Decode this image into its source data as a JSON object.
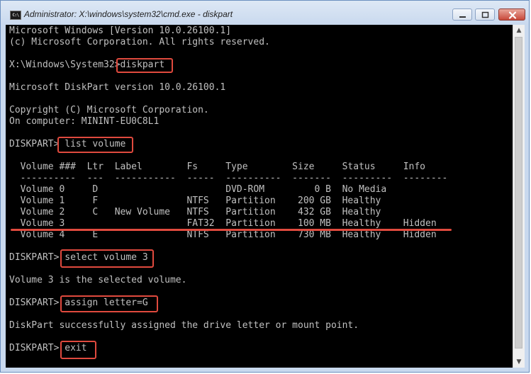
{
  "window": {
    "title": "Administrator: X:\\windows\\system32\\cmd.exe - diskpart",
    "icon_label": "C:\\",
    "icon_name": "cmd-icon"
  },
  "controls": {
    "minimize": "minimize-icon",
    "maximize": "maximize-icon",
    "close": "close-icon"
  },
  "console": {
    "lines": [
      "Microsoft Windows [Version 10.0.26100.1]",
      "(c) Microsoft Corporation. All rights reserved.",
      "",
      "X:\\Windows\\System32>diskpart",
      "",
      "Microsoft DiskPart version 10.0.26100.1",
      "",
      "Copyright (C) Microsoft Corporation.",
      "On computer: MININT-EU0C8L1",
      "",
      "DISKPART> list volume",
      "",
      "  Volume ###  Ltr  Label        Fs     Type        Size     Status     Info",
      "  ----------  ---  -----------  -----  ----------  -------  ---------  --------",
      "  Volume 0     D                       DVD-ROM         0 B  No Media",
      "  Volume 1     F                NTFS   Partition    200 GB  Healthy",
      "  Volume 2     C   New Volume   NTFS   Partition    432 GB  Healthy",
      "  Volume 3                      FAT32  Partition    100 MB  Healthy    Hidden",
      "  Volume 4     E                NTFS   Partition    730 MB  Healthy    Hidden",
      "",
      "DISKPART> select volume 3",
      "",
      "Volume 3 is the selected volume.",
      "",
      "DISKPART> assign letter=G",
      "",
      "DiskPart successfully assigned the drive letter or mount point.",
      "",
      "DISKPART> exit"
    ]
  },
  "annotations": {
    "color": "#e04a3e"
  }
}
